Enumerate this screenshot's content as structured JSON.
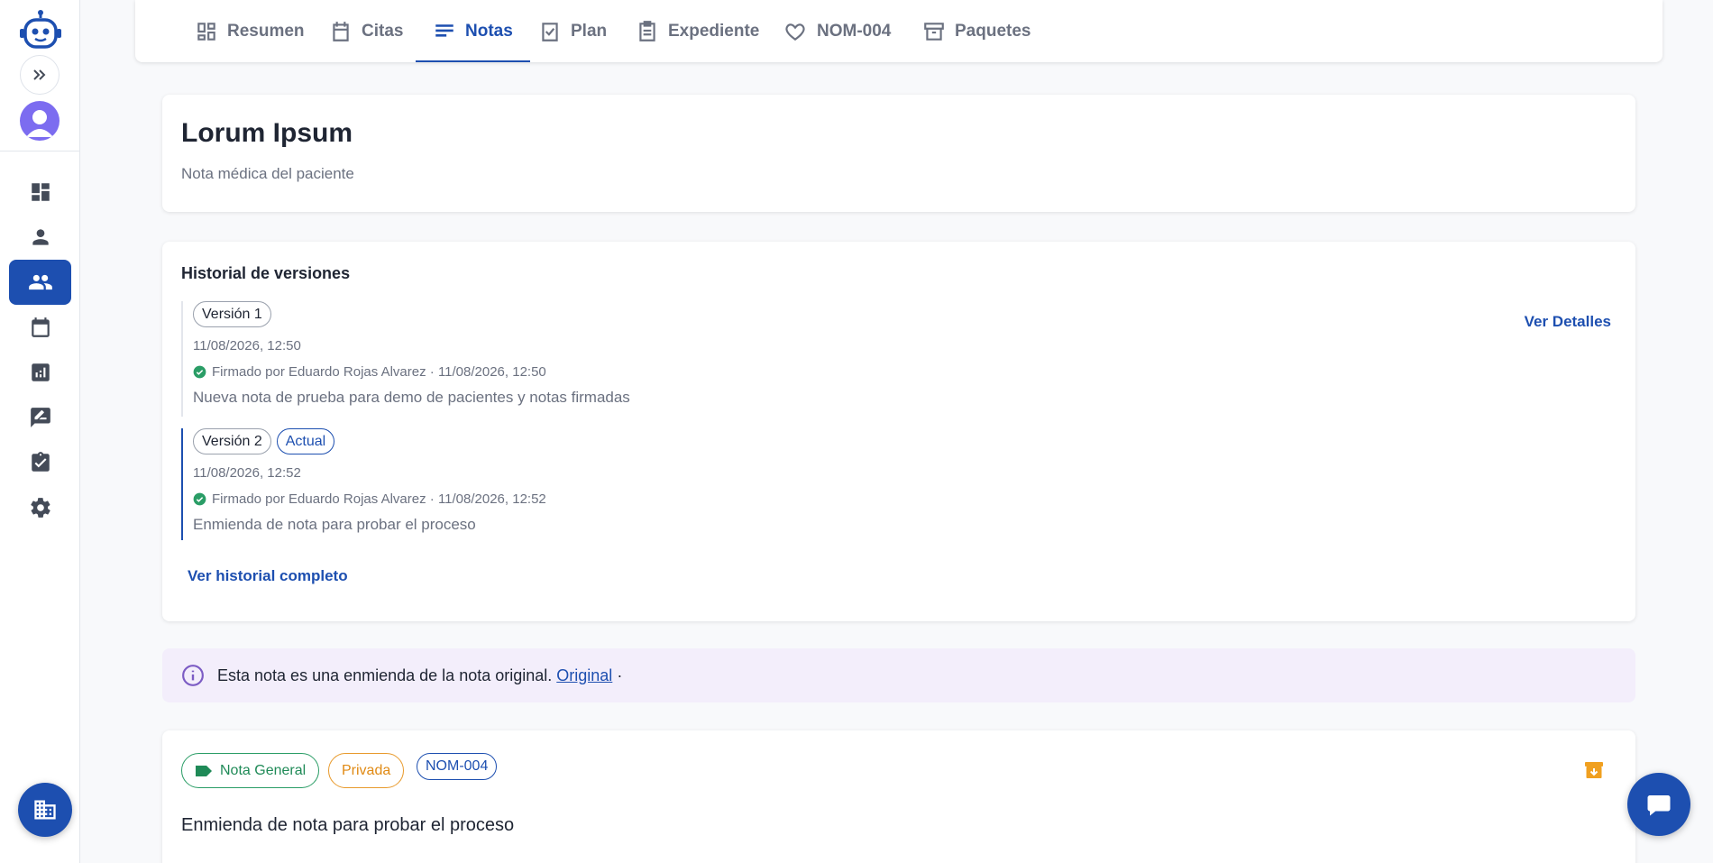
{
  "tabs": [
    {
      "label": "Resumen",
      "icon": "dashboard-icon"
    },
    {
      "label": "Citas",
      "icon": "calendar-icon"
    },
    {
      "label": "Notas",
      "icon": "notes-icon",
      "active": true
    },
    {
      "label": "Plan",
      "icon": "clipboard-check-icon"
    },
    {
      "label": "Expediente",
      "icon": "document-icon"
    },
    {
      "label": "NOM-004",
      "icon": "heart-icon"
    },
    {
      "label": "Paquetes",
      "icon": "archive-icon"
    }
  ],
  "sidebar": {
    "items": [
      "dashboard-icon",
      "person-icon",
      "people-icon",
      "calendar-icon",
      "analytics-icon",
      "rate-review-icon",
      "assignment-check-icon",
      "settings-icon"
    ],
    "active_item": "people-icon"
  },
  "header": {
    "title": "Lorum Ipsum",
    "subtitle": "Nota médica del paciente"
  },
  "history": {
    "title": "Historial de versiones",
    "details_link": "Ver Detalles",
    "full_history_link": "Ver historial completo",
    "versions": [
      {
        "label": "Versión 1",
        "date": "11/08/2026, 12:50",
        "signed": "Firmado por Eduardo Rojas Alvarez · 11/08/2026, 12:50",
        "description": "Nueva nota de prueba para demo de pacientes y notas firmadas"
      },
      {
        "label": "Versión 2",
        "badge": "Actual",
        "date": "11/08/2026, 12:52",
        "signed": "Firmado por Eduardo Rojas Alvarez · 11/08/2026, 12:52",
        "description": "Enmienda de nota para probar el proceso"
      }
    ]
  },
  "amendment": {
    "text": "Esta nota es una enmienda de la nota original.",
    "link": "Original",
    "suffix": "·"
  },
  "note": {
    "tags": {
      "type": "Nota General",
      "privacy": "Privada",
      "norm": "NOM-004"
    },
    "content": "Enmienda de nota para probar el proceso"
  },
  "colors": {
    "primary": "#1d4fb0",
    "success": "#2a9d66",
    "warning": "#e89a2c",
    "info_bg": "#f3eefb"
  }
}
